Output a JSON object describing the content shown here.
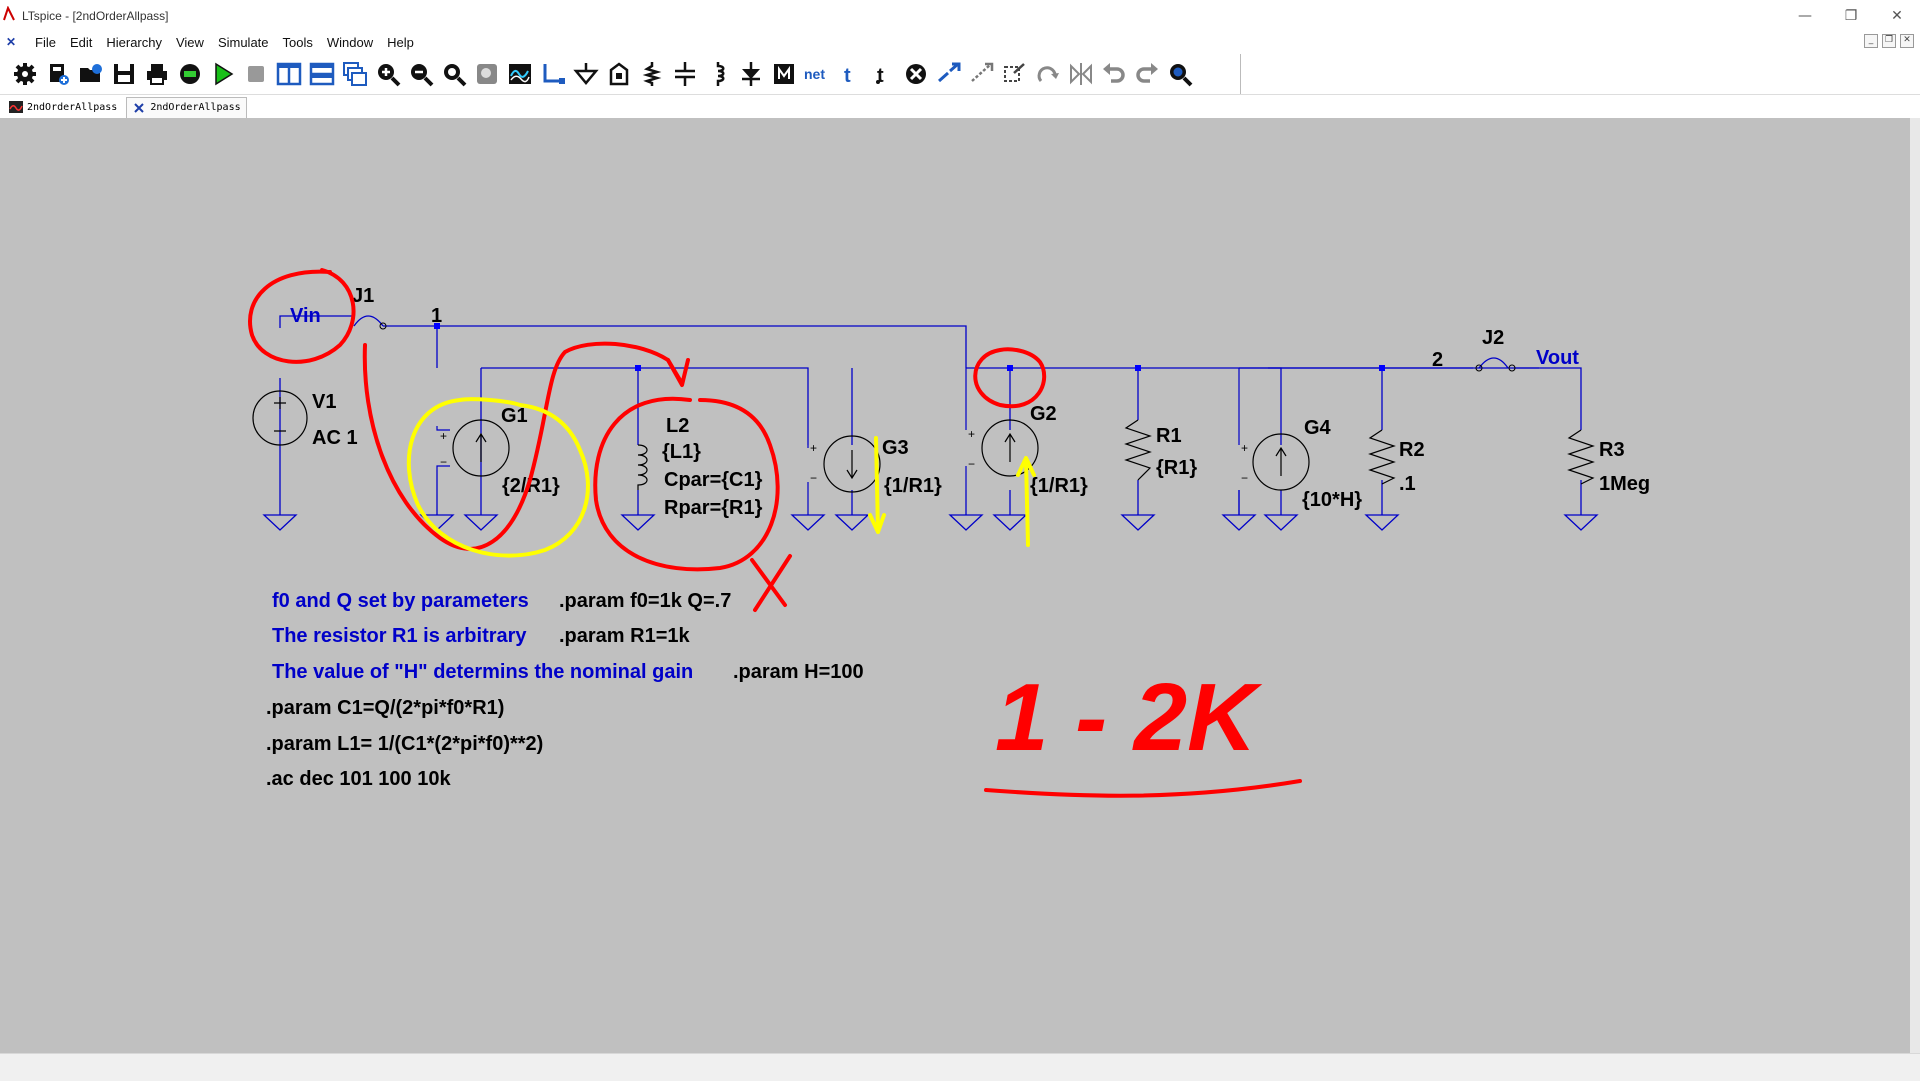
{
  "window": {
    "title": "LTspice - [2ndOrderAllpass]",
    "buttons": [
      "—",
      "❐",
      "✕"
    ]
  },
  "menu": [
    "File",
    "Edit",
    "Hierarchy",
    "View",
    "Simulate",
    "Tools",
    "Window",
    "Help"
  ],
  "mdi_buttons": [
    "_",
    "❐",
    "✕"
  ],
  "toolbar": [
    "settings",
    "new-schematic",
    "open",
    "save",
    "print",
    "control-panel",
    "run",
    "halt",
    "tile-vertical",
    "tile-horizontal",
    "cascade",
    "zoom-in",
    "zoom-out",
    "zoom-fit",
    "zoom-extents",
    "waveform",
    "wire",
    "ground",
    "label-net",
    "resistor",
    "capacitor",
    "inductor",
    "diode",
    "component",
    "move",
    "drag",
    "undo",
    "redo",
    "rotate",
    "mirror",
    "text",
    "spice-directive",
    "delete",
    "duplicate",
    "find"
  ],
  "tabs": [
    {
      "label": "2ndOrderAllpass",
      "kind": "waveform"
    },
    {
      "label": "2ndOrderAllpass",
      "kind": "schematic"
    }
  ],
  "schematic": {
    "net_labels": {
      "vin": "Vin",
      "vout": "Vout",
      "node1": "1",
      "node2": "2"
    },
    "components": {
      "J1": {
        "name": "J1"
      },
      "J2": {
        "name": "J2"
      },
      "V1": {
        "name": "V1",
        "value": "AC 1"
      },
      "G1": {
        "name": "G1",
        "value": "{2/R1}"
      },
      "L2": {
        "name": "L2",
        "value": "{L1}",
        "cpar": "Cpar={C1}",
        "rpar": "Rpar={R1}"
      },
      "G3": {
        "name": "G3",
        "value": "{1/R1}"
      },
      "G2": {
        "name": "G2",
        "value": "{1/R1}"
      },
      "R1": {
        "name": "R1",
        "value": "{R1}"
      },
      "G4": {
        "name": "G4",
        "value": "{10*H}"
      },
      "R2": {
        "name": "R2",
        "value": ".1"
      },
      "R3": {
        "name": "R3",
        "value": "1Meg"
      }
    },
    "comments": [
      "f0 and Q set by parameters",
      "The resistor R1 is arbitrary",
      "The value of \"H\" determins the nominal gain"
    ],
    "directives": [
      ".param f0=1k Q=.7",
      ".param R1=1k",
      ".param H=100",
      ".param C1=Q/(2*pi*f0*R1)",
      ".param L1= 1/(C1*(2*pi*f0)**2)",
      ".ac dec 101 100 10k"
    ],
    "annotation": {
      "text": "1 - 2K",
      "color": "#ff0000",
      "highlight_color": "#ffff00"
    },
    "colors": {
      "wire": "#0000c8",
      "label": "#0000c8",
      "component": "#000000",
      "node_dot": "#0000ff",
      "background": "#c0c0c0",
      "comment": "#0000c8",
      "directive": "#000000"
    }
  }
}
